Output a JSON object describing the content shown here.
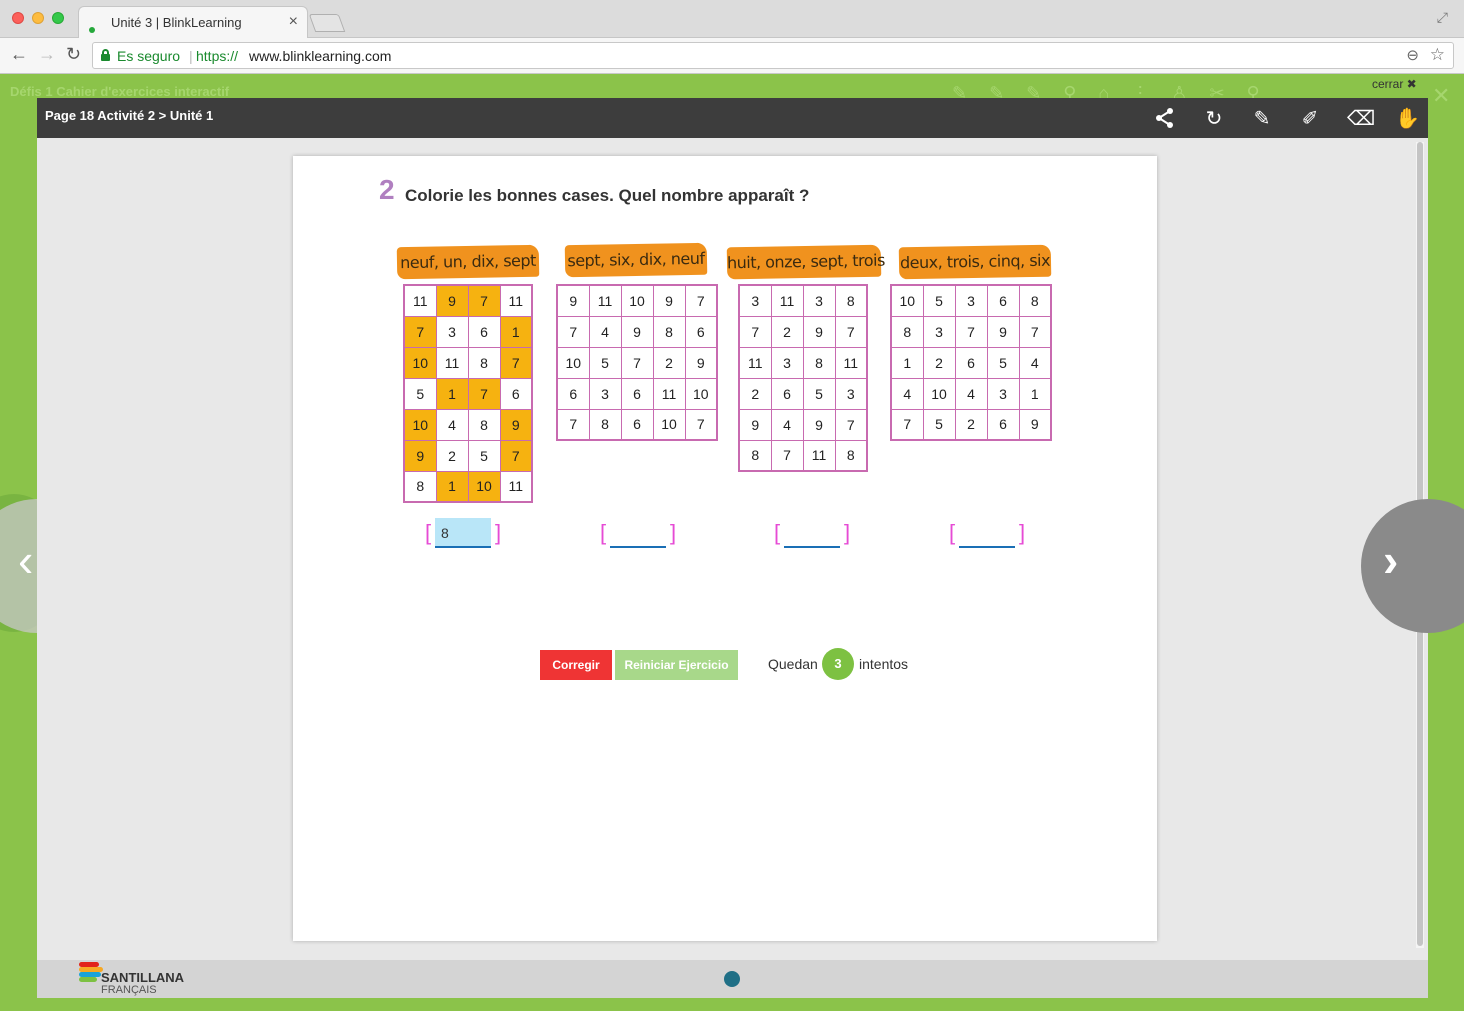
{
  "browser": {
    "tab_title": "Unité 3 | BlinkLearning",
    "secure_label": "Es seguro",
    "url_scheme": "https://",
    "url_host": "www.blinklearning.com"
  },
  "app": {
    "title": "Défis 1 Cahier d'exercices interactif",
    "close_label": "cerrar ✖"
  },
  "viewer": {
    "breadcrumb": "Page 18 Activité 2 > Unité 1",
    "tools": [
      "share-icon",
      "refresh-icon",
      "pencil-icon",
      "marker-icon",
      "eraser-icon",
      "hand-icon"
    ]
  },
  "exercise": {
    "number": "2",
    "title": "Colorie les bonnes cases. Quel nombre apparaît ?",
    "puzzles": [
      {
        "label": "neuf, un, dix, sept",
        "answer": "8",
        "grid": [
          [
            "11",
            "9",
            "7",
            "11"
          ],
          [
            "7",
            "3",
            "6",
            "1"
          ],
          [
            "10",
            "11",
            "8",
            "7"
          ],
          [
            "5",
            "1",
            "7",
            "6"
          ],
          [
            "10",
            "4",
            "8",
            "9"
          ],
          [
            "9",
            "2",
            "5",
            "7"
          ],
          [
            "8",
            "1",
            "10",
            "11"
          ]
        ],
        "highlighted": [
          [
            false,
            true,
            true,
            false
          ],
          [
            true,
            false,
            false,
            true
          ],
          [
            true,
            false,
            false,
            true
          ],
          [
            false,
            true,
            true,
            false
          ],
          [
            true,
            false,
            false,
            true
          ],
          [
            true,
            false,
            false,
            true
          ],
          [
            false,
            true,
            true,
            false
          ]
        ]
      },
      {
        "label": "sept, six, dix, neuf",
        "answer": "",
        "grid": [
          [
            "9",
            "11",
            "10",
            "9",
            "7"
          ],
          [
            "7",
            "4",
            "9",
            "8",
            "6"
          ],
          [
            "10",
            "5",
            "7",
            "2",
            "9"
          ],
          [
            "6",
            "3",
            "6",
            "11",
            "10"
          ],
          [
            "7",
            "8",
            "6",
            "10",
            "7"
          ]
        ]
      },
      {
        "label": "huit, onze, sept, trois",
        "answer": "",
        "grid": [
          [
            "3",
            "11",
            "3",
            "8"
          ],
          [
            "7",
            "2",
            "9",
            "7"
          ],
          [
            "11",
            "3",
            "8",
            "11"
          ],
          [
            "2",
            "6",
            "5",
            "3"
          ],
          [
            "9",
            "4",
            "9",
            "7"
          ],
          [
            "8",
            "7",
            "11",
            "8"
          ]
        ]
      },
      {
        "label": "deux, trois, cinq, six",
        "answer": "",
        "grid": [
          [
            "10",
            "5",
            "3",
            "6",
            "8"
          ],
          [
            "8",
            "3",
            "7",
            "9",
            "7"
          ],
          [
            "1",
            "2",
            "6",
            "5",
            "4"
          ],
          [
            "4",
            "10",
            "4",
            "3",
            "1"
          ],
          [
            "7",
            "5",
            "2",
            "6",
            "9"
          ]
        ]
      }
    ],
    "buttons": {
      "check": "Corregir",
      "reset": "Reiniciar Ejercicio"
    },
    "attempts": {
      "prefix": "Quedan",
      "count": "3",
      "suffix": "intentos"
    }
  },
  "footer": {
    "brand": "SANTILLANA",
    "brand_sub": "FRANÇAIS"
  },
  "colors": {
    "highlight": "#f6b210",
    "label_bg": "#f0921e",
    "grid_border": "#c86ab0",
    "check_button": "#ef3434",
    "reset_button": "#a8d88a",
    "attempt_badge": "#7dc142"
  }
}
